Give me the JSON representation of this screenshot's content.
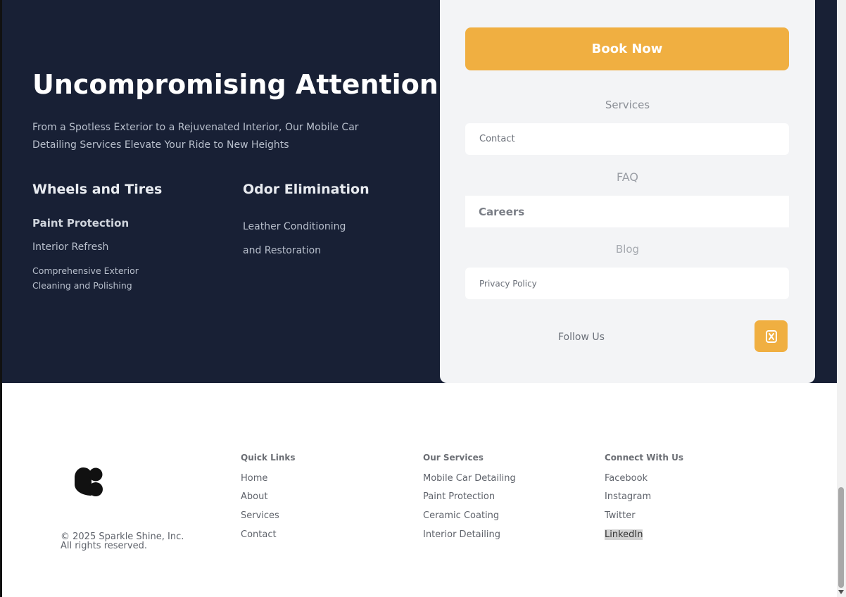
{
  "hero": {
    "title": "Uncompromising Attention",
    "subtitle": "From a Spotless Exterior to a Rejuvenated Interior, Our Mobile Car Detailing Services Elevate Your Ride to New Heights",
    "col1_heading": "Wheels and Tires",
    "col1_items": [
      "Paint Protection",
      "Interior Refresh",
      "Comprehensive Exterior Cleaning and Polishing"
    ],
    "col2_heading": "Odor Elimination",
    "col2_item": "Leather Conditioning and Restoration"
  },
  "panel": {
    "book_label": "Book Now",
    "label_services": "Services",
    "field_contact": "Contact",
    "label_faq": "FAQ",
    "field_careers": "Careers",
    "label_blog": "Blog",
    "field_privacy": "Privacy Policy",
    "follow_label": "Follow Us"
  },
  "footer": {
    "copyright_line1": "© 2025 Sparkle Shine, Inc.",
    "copyright_line2": "All rights reserved.",
    "quick_links": {
      "heading": "Quick Links",
      "items": [
        "Home",
        "About",
        "Services",
        "Contact"
      ]
    },
    "our_services": {
      "heading": "Our Services",
      "items": [
        "Mobile Car Detailing",
        "Paint Protection",
        "Ceramic Coating",
        "Interior Detailing"
      ]
    },
    "connect": {
      "heading": "Connect With Us",
      "items": [
        "Facebook",
        "Instagram",
        "Twitter",
        "LinkedIn"
      ]
    }
  },
  "colors": {
    "hero_bg": "#182035",
    "accent": "#f0af41",
    "panel_bg": "#f3f4f6"
  },
  "icons": {
    "logo": "sparkle-shine-logo",
    "follow": "brand-badge-icon"
  }
}
